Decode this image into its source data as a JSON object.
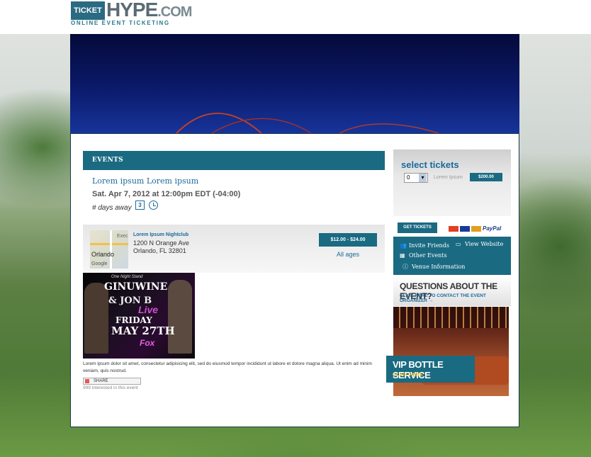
{
  "header": {
    "logo_ticket": "TICKET",
    "logo_hype": "HYPE",
    "logo_com": ".COM",
    "logo_sub": "ONLINE EVENT TICKETING"
  },
  "events": {
    "bar_label": "EVENTS",
    "title": "Lorem ipsum Lorem ipsum",
    "date": "Sat. Apr 7, 2012 at 12:00pm EDT (-04:00)",
    "days_away": "# days away",
    "calendar_day": "3"
  },
  "venue": {
    "map_label": "Orlando",
    "map_extra": "Exec",
    "map_google": "Google",
    "name": "Lorem Ipsum Nightclub",
    "address_line1": "1200 N Orange Ave",
    "address_line2": "Orlando, FL 32801",
    "price_range": "$12.00 - $24.00",
    "ages": "All ages"
  },
  "flyer": {
    "line1": "One Night Stand",
    "line2": "GINUWINE",
    "line3": "& JON B",
    "line4": "Live",
    "line5": "FRIDAY",
    "line6": "MAY 27TH",
    "line7": "Fox"
  },
  "description": "Lorem ipsum dolor sit amet, consectetur adipisicing elit, sed do eiusmod tempor incididunt ut labore et dolore magna aliqua. Ut enim ad minim veniam, quis nostrud.",
  "share_label": "SHARE",
  "interested": "999 interested in this event",
  "sidebar": {
    "select_title": "select tickets",
    "qty_value": "0",
    "ticket_name": "Lorem Ipsum",
    "ticket_price": "$200.00",
    "get_tickets": "GET TICKETS",
    "paypal": "PayPal",
    "links": [
      {
        "label": "Invite Friends",
        "icon": "people-icon"
      },
      {
        "label": "View Website",
        "icon": "monitor-icon"
      },
      {
        "label": "Other Events",
        "icon": "calendar-icon"
      },
      {
        "label": "Venue Information",
        "icon": "info-icon"
      }
    ],
    "questions_title": "QUESTIONS ABOUT THE EVENT?",
    "questions_sub": "CLICK HERE TO CONTACT THE EVENT ORGANIZER →",
    "vip_title": "VIP BOTTLE SERVICE",
    "vip_sub": "CLICK HERE →"
  },
  "colors": {
    "accent": "#1a6a82",
    "link": "#1a6a9a"
  }
}
